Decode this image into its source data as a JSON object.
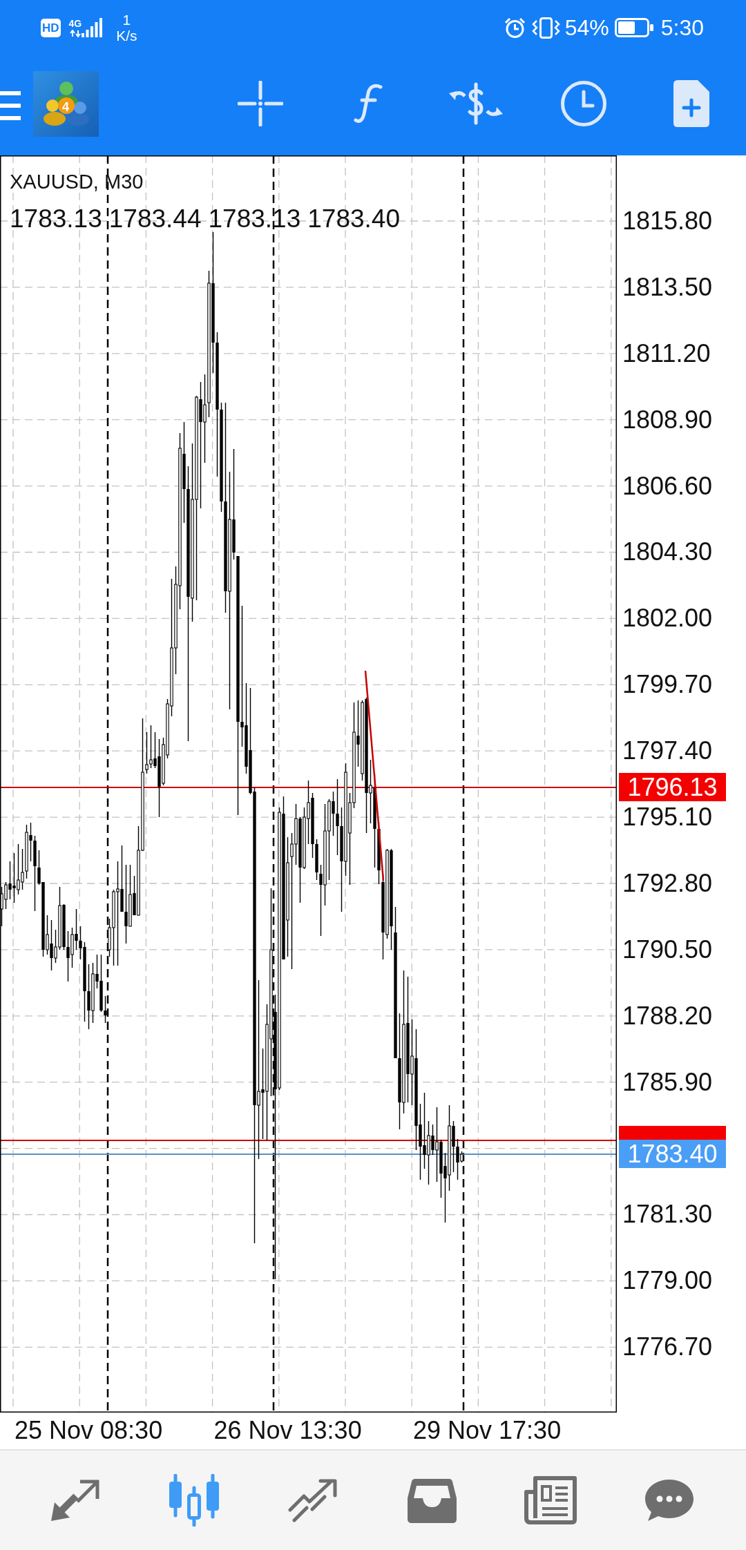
{
  "status_bar": {
    "hd": "HD",
    "network_type": "4G",
    "speed_value": "1",
    "speed_unit": "K/s",
    "battery": "54%",
    "time": "5:30"
  },
  "toolbar": {
    "logo_digit": "4"
  },
  "chart": {
    "symbol": "XAUUSD, M30",
    "ohlc": [
      "1783.13",
      "1783.44",
      "1783.13",
      "1783.40"
    ],
    "price_scale": [
      "1815.80",
      "1813.50",
      "1811.20",
      "1808.90",
      "1806.60",
      "1804.30",
      "1802.00",
      "1799.70",
      "1797.40",
      "1795.10",
      "1792.80",
      "1790.50",
      "1788.20",
      "1785.90",
      "1781.30",
      "1779.00",
      "1776.70"
    ],
    "price_lines": [
      {
        "kind": "horizontal",
        "label": "1796.13"
      },
      {
        "kind": "horizontal"
      },
      {
        "kind": "bid",
        "label": "1783.40"
      }
    ],
    "time_scale": [
      "25 Nov 08:30",
      "26 Nov 13:30",
      "29 Nov 17:30"
    ]
  },
  "bottom_nav": [
    {
      "kind": "arrows",
      "selected": false
    },
    {
      "kind": "candles",
      "selected": true
    },
    {
      "kind": "trend",
      "selected": false
    },
    {
      "kind": "inbox",
      "selected": false
    },
    {
      "kind": "newspaper",
      "selected": false
    },
    {
      "kind": "chat",
      "selected": false
    }
  ]
}
